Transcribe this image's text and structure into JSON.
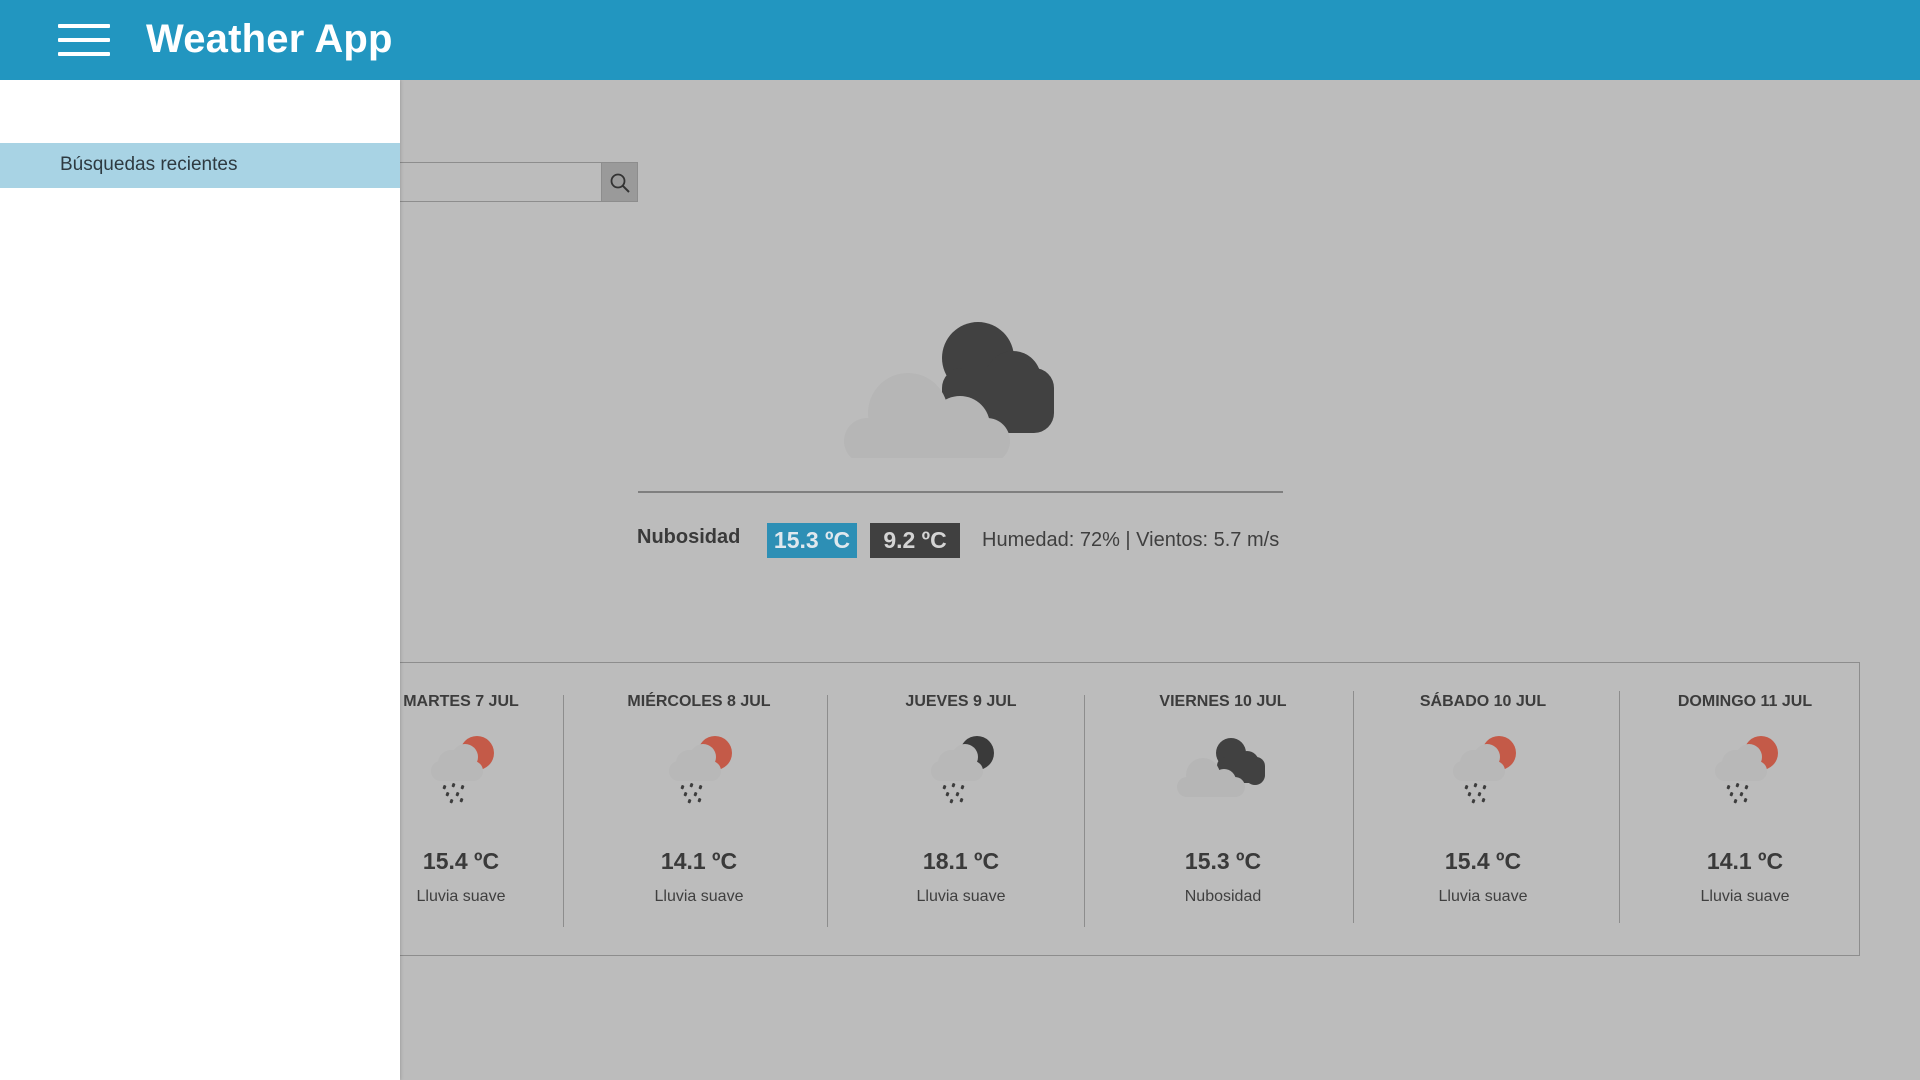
{
  "header": {
    "title": "Weather App",
    "menu_icon": "hamburger-menu-icon",
    "background_color": "#2296c0"
  },
  "drawer": {
    "items": [
      {
        "label": "Búsquedas recientes"
      }
    ],
    "active_color": "#a8d3e4"
  },
  "search": {
    "value": "",
    "button_icon": "search-icon"
  },
  "current": {
    "icon": "cloudy-icon",
    "description": "Nubosidad",
    "temp_max": "15.3 ºC",
    "temp_min": "9.2 ºC",
    "details": "Humedad: 72% | Vientos: 5.7 m/s",
    "temp_max_color": "#2d8fb5",
    "temp_min_color": "#404040"
  },
  "forecast": {
    "days": [
      {
        "name": "MARTES 7 JUL",
        "icon": "light-rain-day-icon",
        "temp": "15.4 ºC",
        "condition": "Lluvia suave"
      },
      {
        "name": "MIÉRCOLES 8 JUL",
        "icon": "light-rain-day-icon",
        "temp": "14.1 ºC",
        "condition": "Lluvia suave"
      },
      {
        "name": "JUEVES 9 JUL",
        "icon": "light-rain-night-icon",
        "temp": "18.1 ºC",
        "condition": "Lluvia suave"
      },
      {
        "name": "VIERNES 10 JUL",
        "icon": "cloudy-icon",
        "temp": "15.3 ºC",
        "condition": "Nubosidad"
      },
      {
        "name": "SÁBADO 10 JUL",
        "icon": "light-rain-day-icon",
        "temp": "15.4 ºC",
        "condition": "Lluvia suave"
      },
      {
        "name": "DOMINGO 11 JUL",
        "icon": "light-rain-day-icon",
        "temp": "14.1 ºC",
        "condition": "Lluvia suave"
      }
    ]
  }
}
